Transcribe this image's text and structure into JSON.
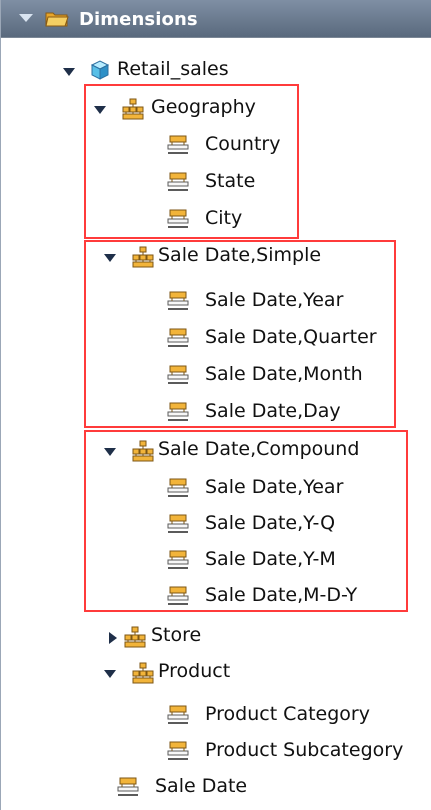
{
  "header": {
    "title": "Dimensions"
  },
  "tree": {
    "root": "Retail_sales",
    "geography": {
      "label": "Geography",
      "items": [
        "Country",
        "State",
        "City"
      ]
    },
    "sale_simple": {
      "label": "Sale Date,Simple",
      "items": [
        "Sale Date,Year",
        "Sale Date,Quarter",
        "Sale Date,Month",
        "Sale Date,Day"
      ]
    },
    "sale_compound": {
      "label": "Sale Date,Compound",
      "items": [
        "Sale Date,Year",
        "Sale Date,Y-Q",
        "Sale Date,Y-M",
        "Sale Date,M-D-Y"
      ]
    },
    "store": {
      "label": "Store"
    },
    "product": {
      "label": "Product",
      "items": [
        "Product Category",
        "Product Subcategory"
      ]
    },
    "sale_date": {
      "label": "Sale Date"
    }
  }
}
